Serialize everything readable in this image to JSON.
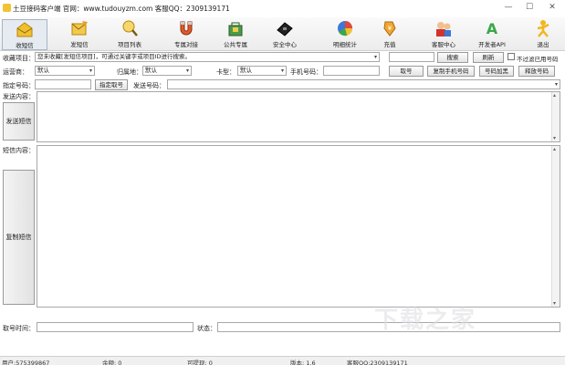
{
  "window": {
    "title": "土豆接码客户端  官网：www.tudouyzm.com  客服QQ：2309139171",
    "minimize": "—",
    "maximize": "☐",
    "close": "✕"
  },
  "toolbar": {
    "items": [
      {
        "label": "收短信",
        "icon": "receive-sms-icon"
      },
      {
        "label": "发短信",
        "icon": "send-sms-icon"
      },
      {
        "label": "项目列表",
        "icon": "project-list-icon"
      },
      {
        "label": "专属对接",
        "icon": "magnet-icon"
      },
      {
        "label": "公共专属",
        "icon": "shopping-bag-icon"
      },
      {
        "label": "安全中心",
        "icon": "shield-icon"
      },
      {
        "label": "明细统计",
        "icon": "pie-chart-icon"
      },
      {
        "label": "充值",
        "icon": "recharge-icon"
      },
      {
        "label": "客服中心",
        "icon": "support-icon"
      },
      {
        "label": "开发者API",
        "icon": "developer-api-icon"
      },
      {
        "label": "退出",
        "icon": "exit-icon"
      }
    ]
  },
  "form": {
    "collect_label": "收藏项目：",
    "collect_value": "您未收藏[发短信项目]，可通过关键字或项目ID进行搜索。",
    "search_button": "搜索",
    "refresh_button": "刷新",
    "filter_checkbox": "不过滤已用号码",
    "operator_label": "运营商：",
    "operator_value": "默认",
    "location_label": "归属地：",
    "location_value": "默认",
    "card_label": "卡型：",
    "card_value": "默认",
    "phone_label": "手机号码：",
    "phone_value": "",
    "get_number_button": "取号",
    "copy_phone_button": "复制手机号码",
    "blacklist_button": "号码加黑",
    "release_button": "释放号码",
    "assign_label": "指定号码：",
    "assign_value": "",
    "assign_button": "指定取号",
    "send_number_label": "发送号码：",
    "send_number_value": "",
    "send_content_label": "发送内容：",
    "send_sms_button": "发送短信",
    "sms_content_label": "短信内容：",
    "copy_sms_button": "复制短信",
    "time_label": "取号时间：",
    "time_value": "",
    "status_label": "状态：",
    "status_value": ""
  },
  "statusbar": {
    "user": "用户:575399867",
    "balance": "余额: 0",
    "available": "可提现: 0",
    "version": "版本: 1.6",
    "qq": "客服QQ:2309139171"
  },
  "watermark": "下载之家",
  "colors": {
    "accent": "#e6ebf2",
    "border": "#a8a8a8",
    "toolbar_bg": "#ececec"
  }
}
